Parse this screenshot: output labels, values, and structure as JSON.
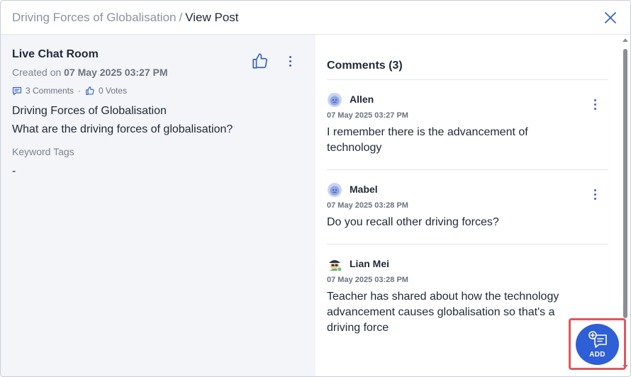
{
  "header": {
    "breadcrumb_parent": "Driving Forces of Globalisation",
    "breadcrumb_separator": "/",
    "breadcrumb_current": "View Post"
  },
  "post": {
    "title": "Live Chat Room",
    "created_prefix": "Created on",
    "created_date": "07 May 2025 03:27 PM",
    "comments_count": "3 Comments",
    "meta_separator": "·",
    "votes_count": "0 Votes",
    "body_line1": "Driving Forces of Globalisation",
    "body_line2": "What are the driving forces of globalisation?",
    "keyword_label": "Keyword Tags",
    "keyword_value": "-"
  },
  "comments": {
    "title": "Comments (3)",
    "items": [
      {
        "author": "Allen",
        "date": "07 May 2025 03:27 PM",
        "text": "I remember there is the advancement of technology"
      },
      {
        "author": "Mabel",
        "date": "07 May 2025 03:28 PM",
        "text": "Do you recall other driving forces?"
      },
      {
        "author": "Lian Mei",
        "date": "07 May 2025 03:28 PM",
        "text": "Teacher has shared about how the technology advancement causes globalisation so that's a driving force"
      }
    ]
  },
  "add_button": {
    "label": "ADD"
  },
  "icons": {
    "close": "close-icon",
    "like": "thumbs-up-icon",
    "more": "more-vertical-icon",
    "comment": "comment-icon",
    "add_comment": "add-comment-icon"
  },
  "colors": {
    "accent": "#2f5fd6",
    "highlight": "#e0575e",
    "left_pane_bg": "#f3f5f8"
  }
}
